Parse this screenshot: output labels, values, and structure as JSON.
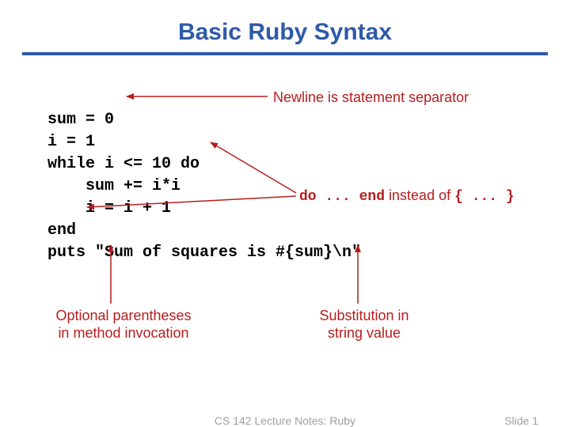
{
  "title": "Basic Ruby Syntax",
  "code": {
    "l1": "sum = 0",
    "l2": "i = 1",
    "l3": "while i <= 10 do",
    "l4": "    sum += i*i",
    "l5": "    i = i + 1",
    "l6": "end",
    "l7": "puts \"Sum of squares is #{sum}\\n\""
  },
  "annotations": {
    "newline": "Newline is statement separator",
    "do_end_prefix": "do ... end",
    "do_end_mid": " instead of ",
    "do_end_suffix": "{ ... }",
    "optional_paren_l1": "Optional parentheses",
    "optional_paren_l2": "in method invocation",
    "substitution_l1": "Substitution in",
    "substitution_l2": "string value"
  },
  "footer": {
    "center": "CS 142 Lecture Notes: Ruby",
    "right": "Slide 1"
  },
  "colors": {
    "title": "#2e5aa8",
    "annotation": "#b71c1c"
  }
}
